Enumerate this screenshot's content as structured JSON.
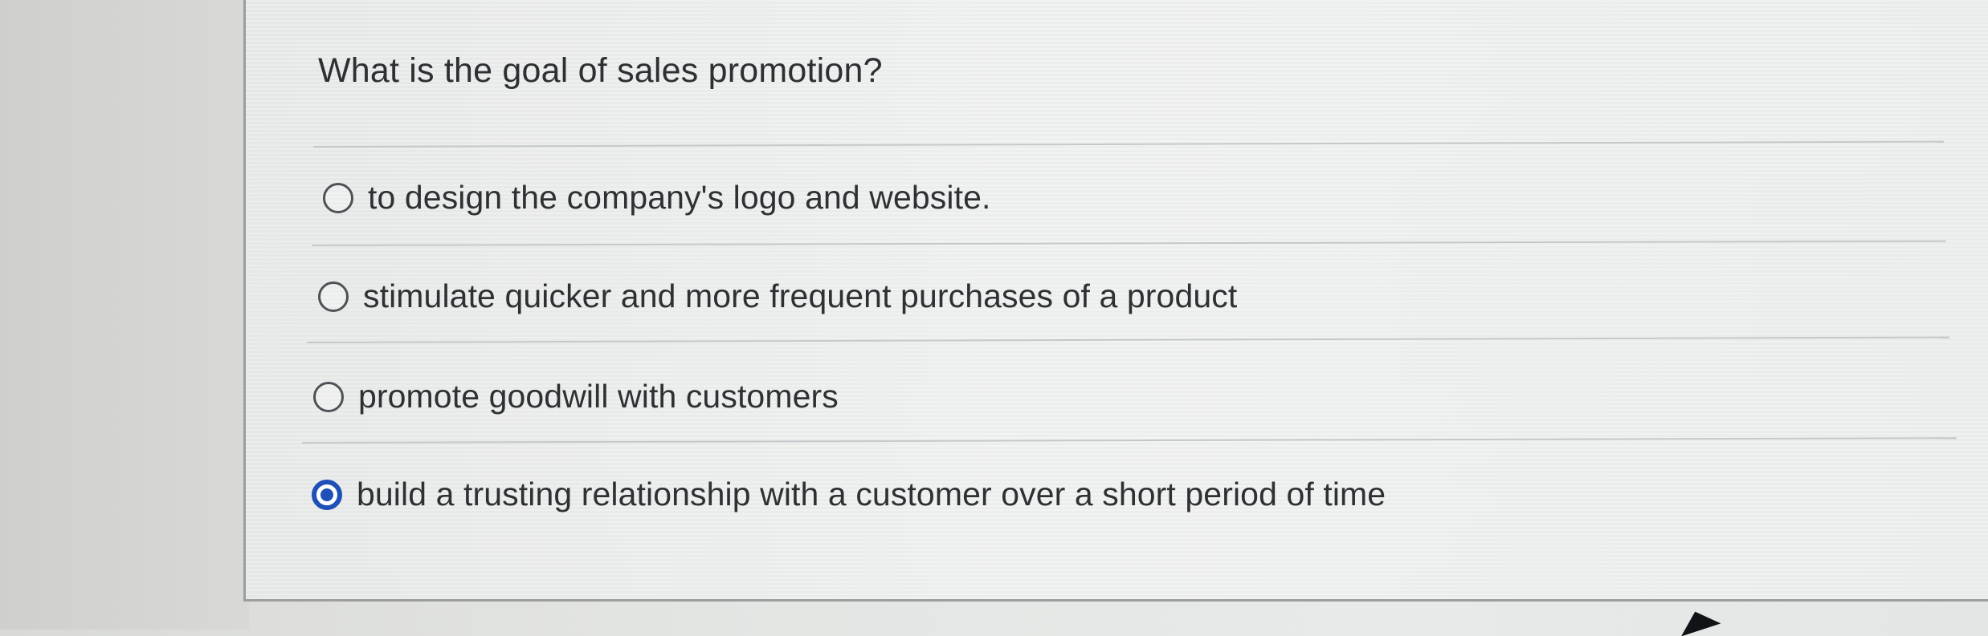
{
  "question": {
    "text": "What is the goal of sales promotion?"
  },
  "options": [
    {
      "label": "to design the company's logo and website.",
      "selected": false
    },
    {
      "label": "stimulate quicker and more frequent purchases of a product",
      "selected": false
    },
    {
      "label": "promote goodwill with customers",
      "selected": false
    },
    {
      "label": "build a trusting relationship with a customer over a short period of time",
      "selected": true
    }
  ],
  "colors": {
    "background": "#e4e6e6",
    "panel_background": "#eceeed",
    "text": "#2f3033",
    "separator": "#c5c8ca",
    "radio_border": "#4e5156",
    "selected_radio": "#1f50b8"
  },
  "icons": {
    "unselected_radio": "radio-unselected-icon",
    "selected_radio": "radio-selected-icon",
    "cursor": "mouse-cursor-icon"
  }
}
